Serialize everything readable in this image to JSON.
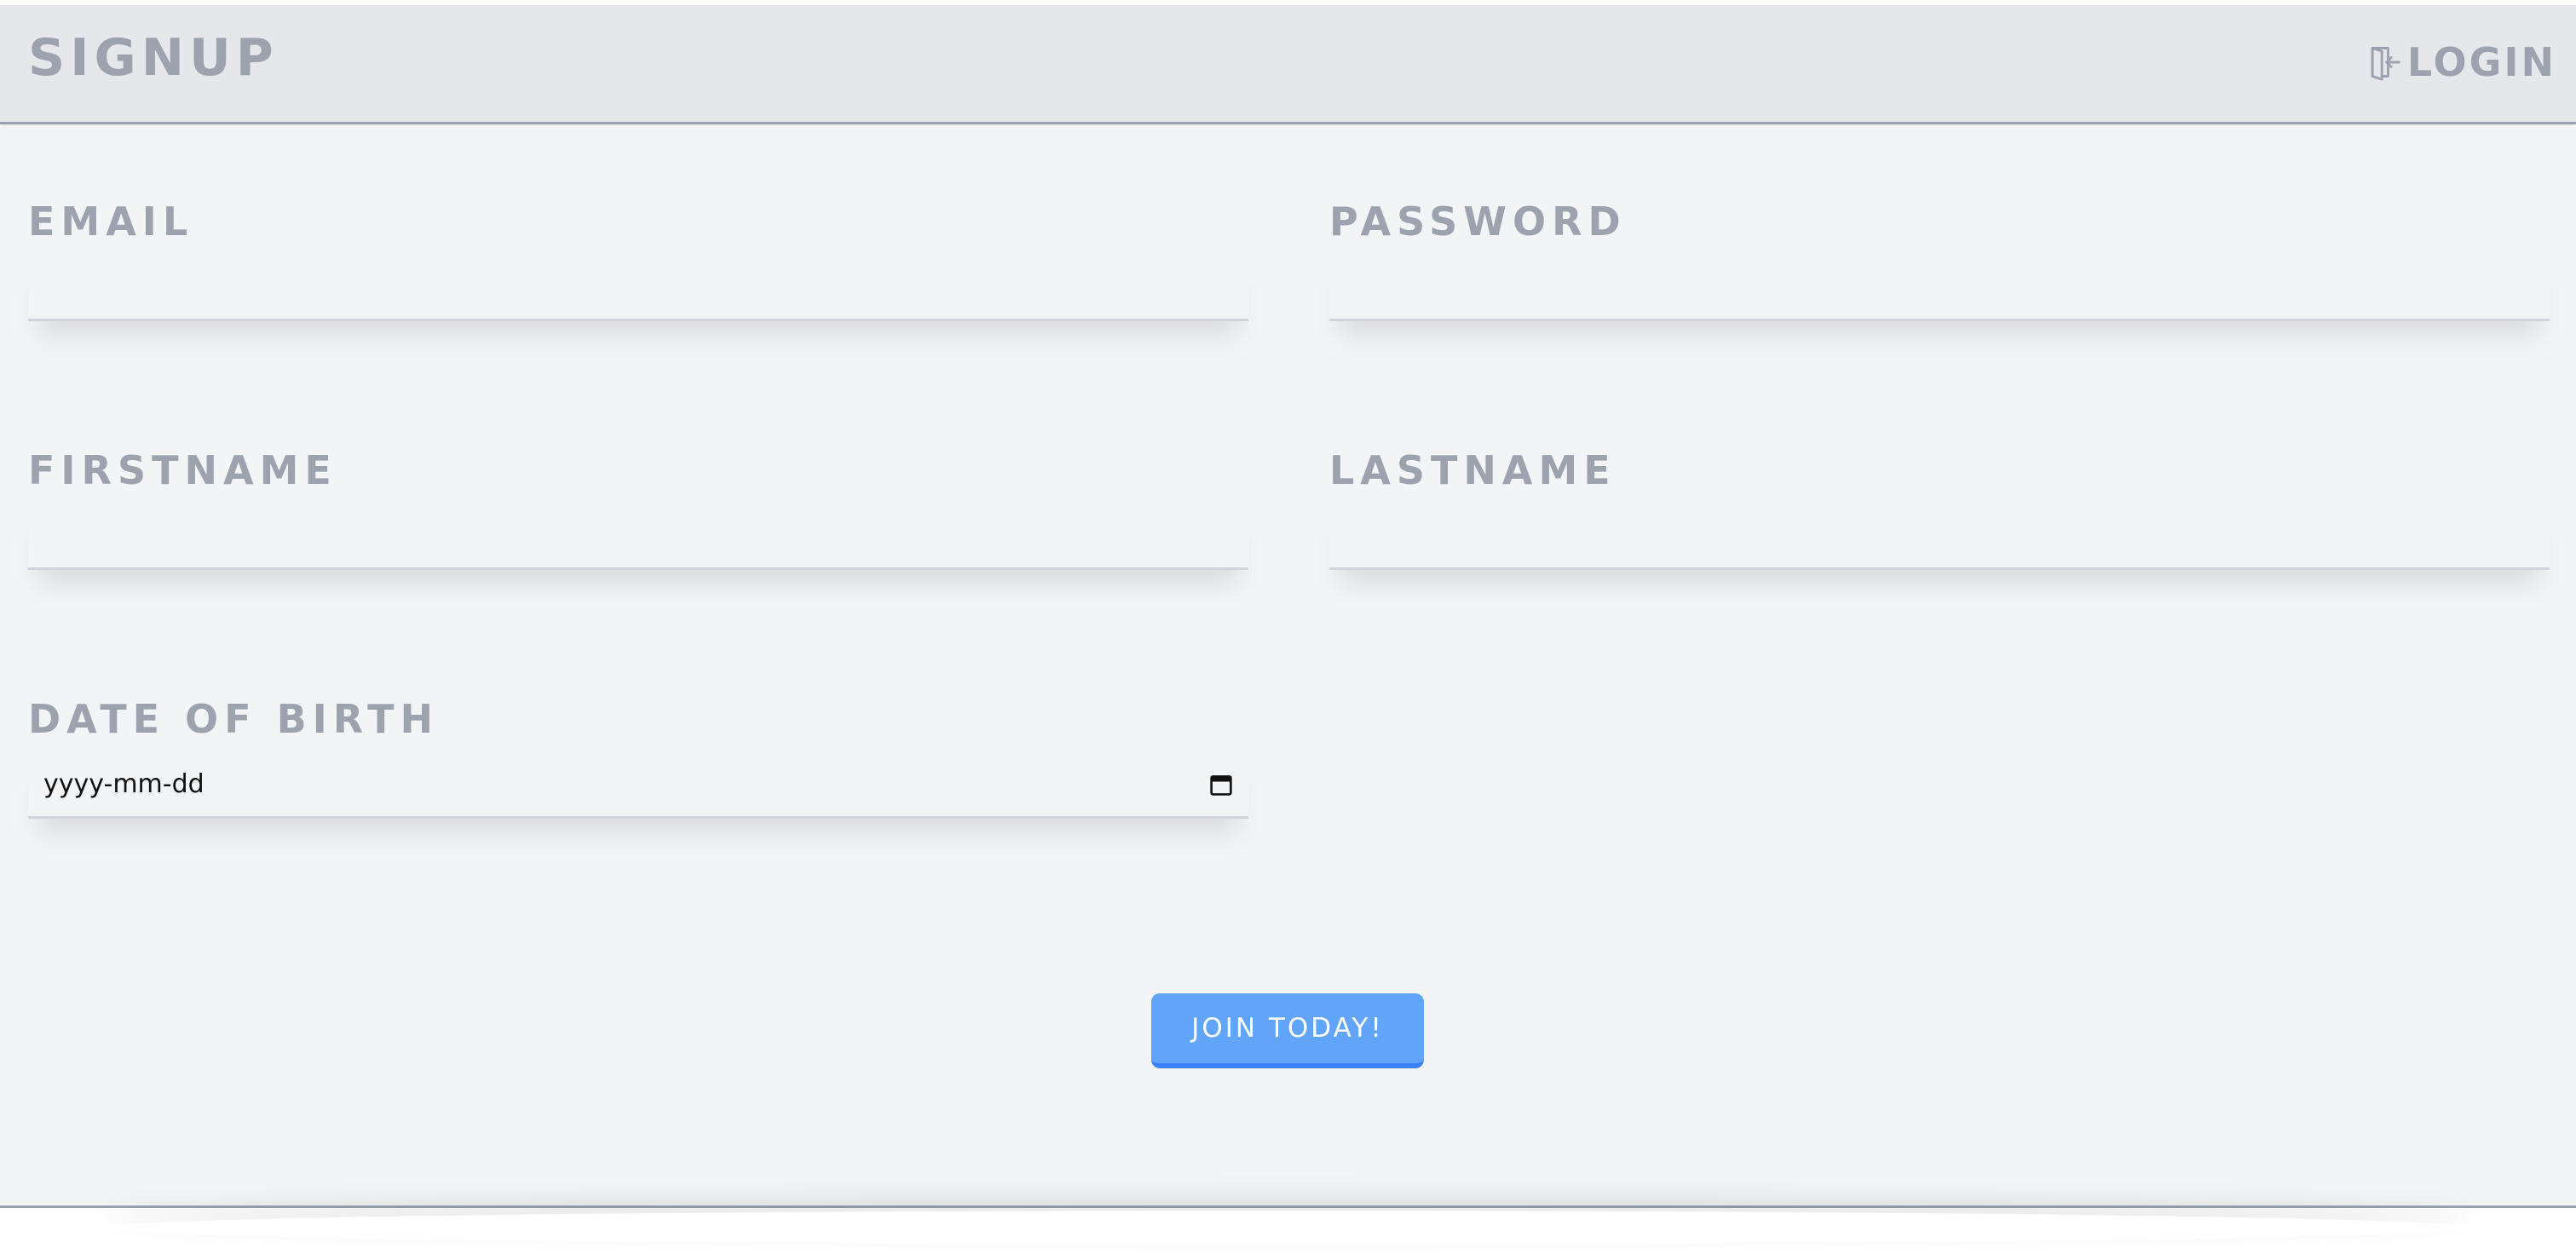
{
  "header": {
    "brand": "SIGNUP",
    "login_label": "LOGIN",
    "login_icon": "login-door-icon"
  },
  "form": {
    "email_label": "EMAIL",
    "password_label": "PASSWORD",
    "firstname_label": "FIRSTNAME",
    "lastname_label": "LASTNAME",
    "dob_label": "DATE OF BIRTH",
    "dob_placeholder": "yyyy-mm-dd",
    "dob_icon": "calendar-icon",
    "submit_label": "JOIN TODAY!"
  },
  "colors": {
    "header_bg": "#e5e7eb",
    "page_bg": "#f3f4f6",
    "label_gray": "#9ca3af",
    "button_blue": "#60a5fa"
  }
}
